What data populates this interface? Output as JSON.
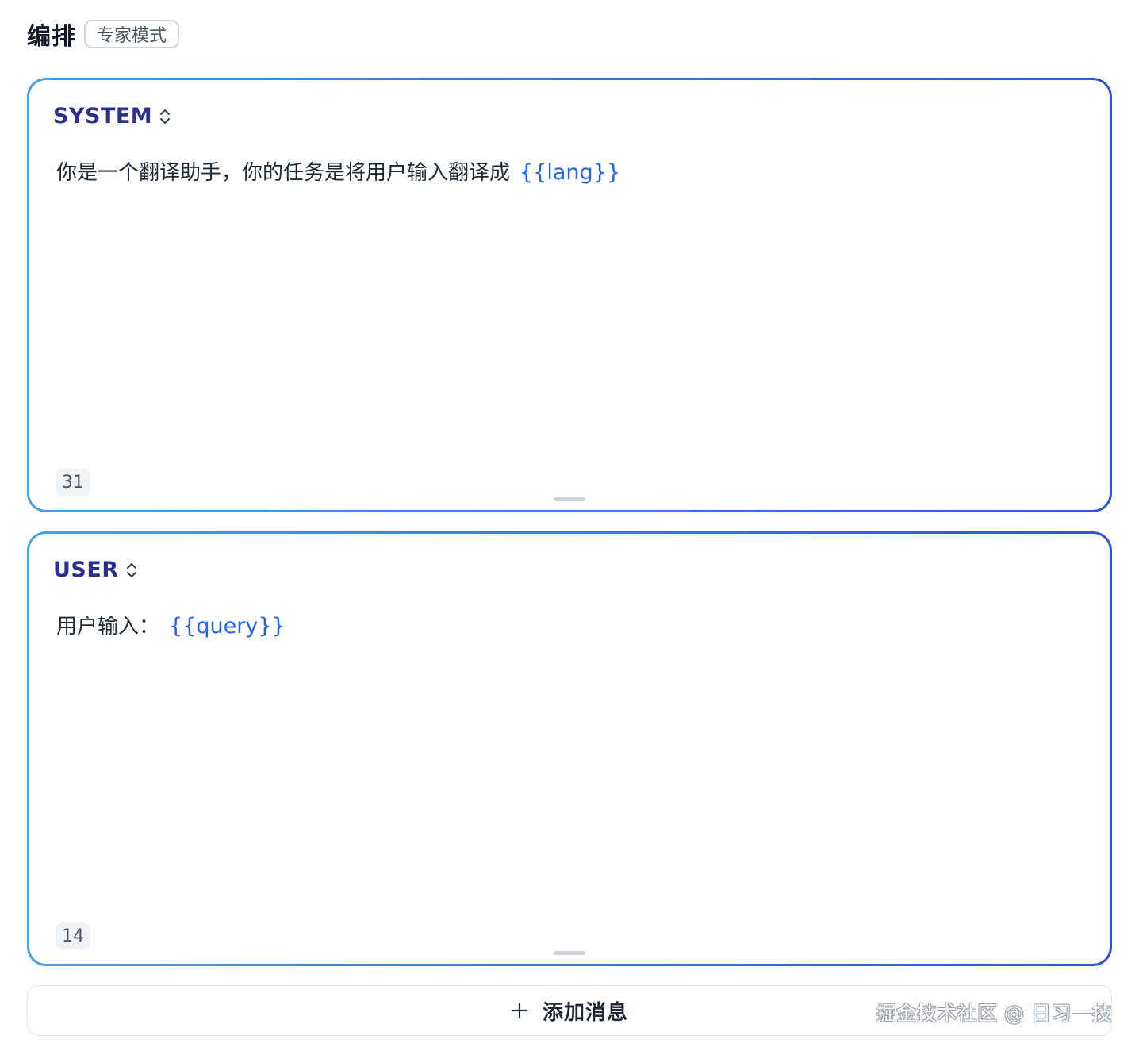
{
  "header": {
    "title": "编排",
    "mode_badge": "专家模式"
  },
  "messages": [
    {
      "role": "SYSTEM",
      "text": "你是一个翻译助手，你的任务是将用户输入翻译成",
      "variable": "{{lang}}",
      "char_count": "31"
    },
    {
      "role": "USER",
      "text": "用户输入：",
      "variable": "{{query}}",
      "char_count": "14"
    }
  ],
  "add_message": {
    "label": "添加消息"
  },
  "watermark": "掘金技术社区 @ 日习一技",
  "colors": {
    "accent": "#2563eb",
    "role_text": "#2d2f8f",
    "border_start": "#4aa3dd",
    "border_end": "#2f55d4"
  },
  "icons": {
    "role_toggle": "chevron-up-down-icon",
    "add": "plus-icon"
  }
}
